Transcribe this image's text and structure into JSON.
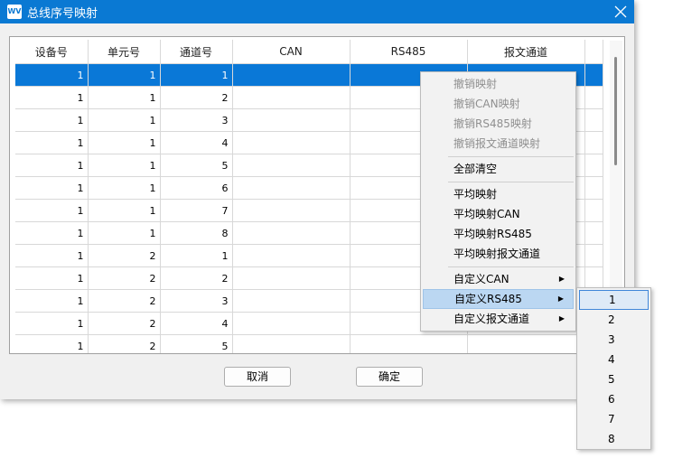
{
  "window": {
    "title": "总线序号映射",
    "icon_label": "WV"
  },
  "table": {
    "columns": [
      "设备号",
      "单元号",
      "通道号",
      "CAN",
      "RS485",
      "报文通道"
    ],
    "rows": [
      [
        "1",
        "1",
        "1",
        "",
        "",
        ""
      ],
      [
        "1",
        "1",
        "2",
        "",
        "",
        ""
      ],
      [
        "1",
        "1",
        "3",
        "",
        "",
        ""
      ],
      [
        "1",
        "1",
        "4",
        "",
        "",
        ""
      ],
      [
        "1",
        "1",
        "5",
        "",
        "",
        ""
      ],
      [
        "1",
        "1",
        "6",
        "",
        "",
        ""
      ],
      [
        "1",
        "1",
        "7",
        "",
        "",
        ""
      ],
      [
        "1",
        "1",
        "8",
        "",
        "",
        ""
      ],
      [
        "1",
        "2",
        "1",
        "",
        "",
        ""
      ],
      [
        "1",
        "2",
        "2",
        "",
        "",
        ""
      ],
      [
        "1",
        "2",
        "3",
        "",
        "",
        ""
      ],
      [
        "1",
        "2",
        "4",
        "",
        "",
        ""
      ],
      [
        "1",
        "2",
        "5",
        "",
        "",
        ""
      ]
    ]
  },
  "buttons": {
    "cancel": "取消",
    "ok": "确定"
  },
  "context_menu": {
    "items": [
      "撤销映射",
      "撤销CAN映射",
      "撤销RS485映射",
      "撤销报文通道映射",
      "全部清空",
      "平均映射",
      "平均映射CAN",
      "平均映射RS485",
      "平均映射报文通道",
      "自定义CAN",
      "自定义RS485",
      "自定义报文通道"
    ],
    "submenu_arrow": "▶"
  },
  "submenu": {
    "items": [
      "1",
      "2",
      "3",
      "4",
      "5",
      "6",
      "7",
      "8"
    ]
  }
}
